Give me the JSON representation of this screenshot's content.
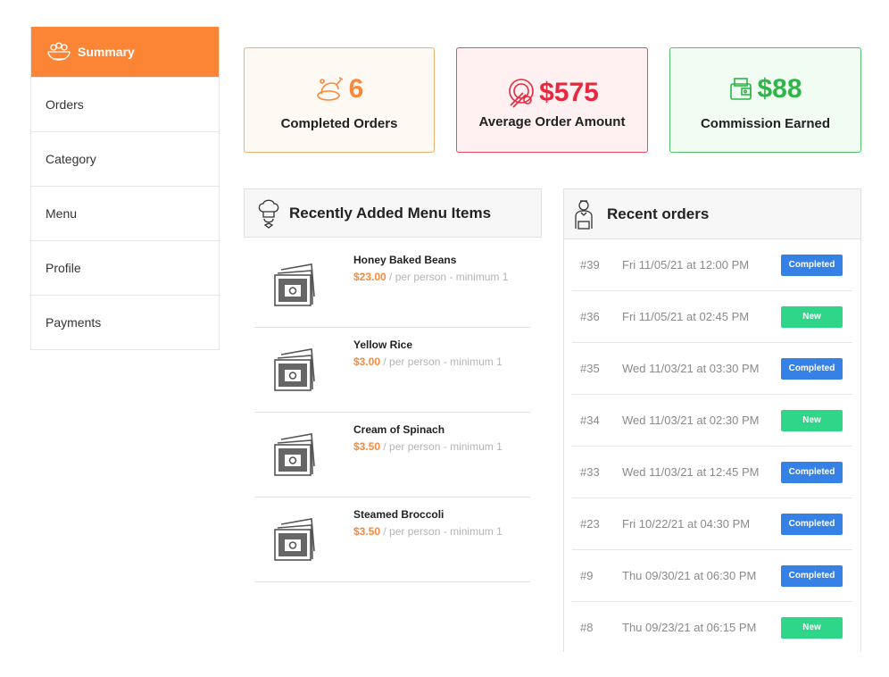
{
  "sidebar": {
    "items": [
      {
        "label": "Summary",
        "icon": "salad-bowl-icon",
        "active": true
      },
      {
        "label": "Orders"
      },
      {
        "label": "Category"
      },
      {
        "label": "Menu"
      },
      {
        "label": "Profile"
      },
      {
        "label": "Payments"
      }
    ]
  },
  "stats": {
    "completed": {
      "value": "6",
      "label": "Completed Orders",
      "icon": "chicken-plate-icon"
    },
    "average": {
      "value": "$575",
      "label": "Average Order Amount",
      "icon": "plate-fork-icon"
    },
    "commission": {
      "value": "$88",
      "label": "Commission Earned",
      "icon": "wallet-icon"
    }
  },
  "menu_panel": {
    "title": "Recently Added Menu Items",
    "icon": "chef-hat-icon",
    "price_suffix": " / per person - minimum 1",
    "items": [
      {
        "name": "Honey Baked Beans",
        "price": "$23.00"
      },
      {
        "name": "Yellow Rice",
        "price": "$3.00"
      },
      {
        "name": "Cream of Spinach",
        "price": "$3.50"
      },
      {
        "name": "Steamed Broccoli",
        "price": "$3.50"
      }
    ]
  },
  "orders_panel": {
    "title": "Recent orders",
    "icon": "waiter-icon",
    "orders": [
      {
        "id": "#39",
        "date": "Fri 11/05/21 at 12:00 PM",
        "status": "Completed"
      },
      {
        "id": "#36",
        "date": "Fri 11/05/21 at 02:45 PM",
        "status": "New"
      },
      {
        "id": "#35",
        "date": "Wed 11/03/21 at 03:30 PM",
        "status": "Completed"
      },
      {
        "id": "#34",
        "date": "Wed 11/03/21 at 02:30 PM",
        "status": "New"
      },
      {
        "id": "#33",
        "date": "Wed 11/03/21 at 12:45 PM",
        "status": "Completed"
      },
      {
        "id": "#23",
        "date": "Fri 10/22/21 at 04:30 PM",
        "status": "Completed"
      },
      {
        "id": "#9",
        "date": "Thu 09/30/21 at 06:30 PM",
        "status": "Completed"
      },
      {
        "id": "#8",
        "date": "Thu 09/23/21 at 06:15 PM",
        "status": "New"
      }
    ]
  },
  "colors": {
    "accent": "#fb8435",
    "completed_badge": "#3581e6",
    "new_badge": "#2fd589"
  }
}
